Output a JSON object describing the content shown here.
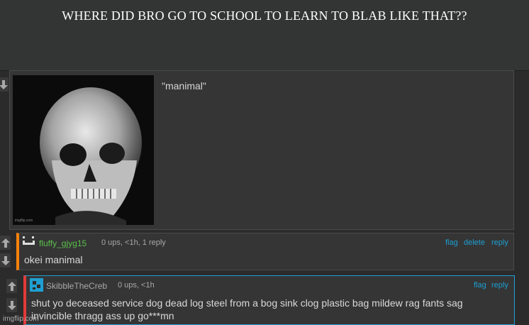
{
  "meme": {
    "caption": "WHERE DID BRO GO TO SCHOOL TO LEARN TO BLAB LIKE THAT??"
  },
  "post": {
    "quote_text": "\"manimal\"",
    "image_watermark": "imgflip.com",
    "image_subject": "skull"
  },
  "comments": [
    {
      "username": "fluffy_gjyg15",
      "meta": "0 ups, <1h, 1 reply",
      "actions": [
        "flag",
        "delete",
        "reply"
      ],
      "text": "okei manimal",
      "accent_color": "#f5820a",
      "username_color": "#5bbf4a"
    },
    {
      "username": "SkibbleTheCreb",
      "meta": "0 ups, <1h",
      "actions": [
        "flag",
        "reply"
      ],
      "text_line1": "shut yo deceased service dog dead log steel from a bog sink clog plastic bag mildew rag fants sag",
      "text_line2": "invincible thragg ass up go***mn",
      "accent_color": "#e23a3a",
      "username_color": "#a8a8a8"
    }
  ],
  "footer": {
    "watermark": "imgflip.com"
  },
  "colors": {
    "link": "#1e9fd3",
    "panel_bg": "#353535",
    "page_bg": "#2b2b2b"
  }
}
